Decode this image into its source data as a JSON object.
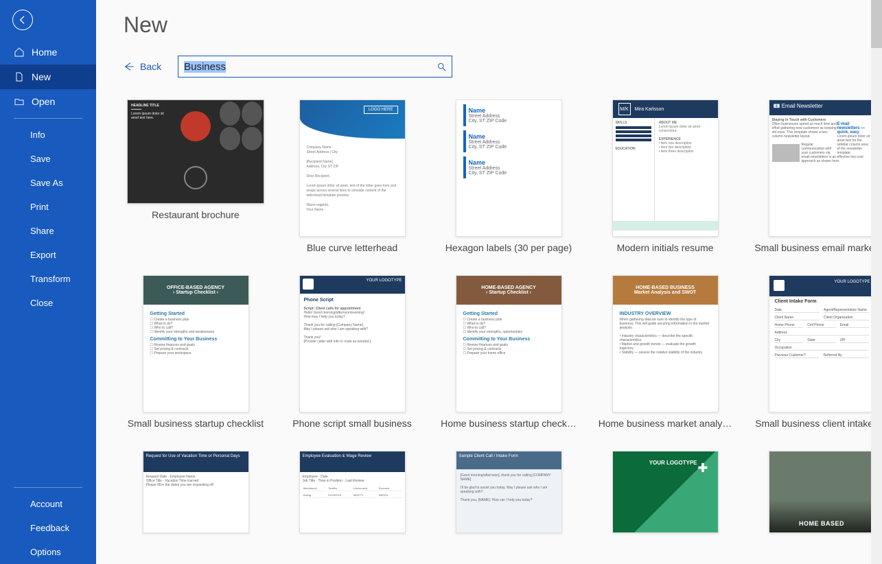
{
  "page_title": "New",
  "search_value": "Business",
  "back_label": "Back",
  "sidebar": {
    "nav": [
      {
        "label": "Home"
      },
      {
        "label": "New"
      },
      {
        "label": "Open"
      }
    ],
    "actions": [
      {
        "label": "Info"
      },
      {
        "label": "Save"
      },
      {
        "label": "Save As"
      },
      {
        "label": "Print"
      },
      {
        "label": "Share"
      },
      {
        "label": "Export"
      },
      {
        "label": "Transform"
      },
      {
        "label": "Close"
      }
    ],
    "footer": [
      {
        "label": "Account"
      },
      {
        "label": "Feedback"
      },
      {
        "label": "Options"
      }
    ]
  },
  "templates": [
    {
      "label": "Restaurant brochure"
    },
    {
      "label": "Blue curve letterhead"
    },
    {
      "label": "Hexagon labels (30 per page)"
    },
    {
      "label": "Modern initials resume"
    },
    {
      "label": "Small business email marketi…"
    },
    {
      "label": "Small business startup checklist"
    },
    {
      "label": "Phone script small business"
    },
    {
      "label": "Home business startup check…"
    },
    {
      "label": "Home business market analy…"
    },
    {
      "label": "Small business client intake f…"
    }
  ],
  "thumbtext": {
    "logo_here": "LOGO HERE",
    "headline": "HEADLINE TITLE",
    "hex_name": "Name",
    "hex_addr1": "Street Address",
    "hex_addr2": "City, ST ZIP Code",
    "mk": "M/K",
    "mk_name": "Mira Karlsson",
    "about": "ABOUT ME",
    "skills": "SKILLS",
    "experience": "EXPERIENCE",
    "education": "EDUCATION",
    "news_title": "Email Newsletter",
    "news_call": "E-mail newsletters — quick, easy",
    "office_agency": "OFFICE-BASED AGENCY",
    "startup_checklist": "› Startup Checklist ‹",
    "getting_started": "Getting Started",
    "committing": "Committing to Your Business",
    "phone_script": "Phone Script",
    "home_agency": "HOME-BASED AGENCY",
    "home_business": "HOME-BASED BUSINESS",
    "market_swot": "Market Analysis and SWOT",
    "industry": "INDUSTRY OVERVIEW",
    "intake_form": "Client Intake Form",
    "your_logotype": "YOUR LOGOTYPE",
    "vacation": "Request for Use of Vacation Time or Personal Days",
    "eval": "Employee Evaluation & Wage Review",
    "sample_call": "Sample Client Call / Intake Form",
    "home_based": "HOME BASED"
  }
}
